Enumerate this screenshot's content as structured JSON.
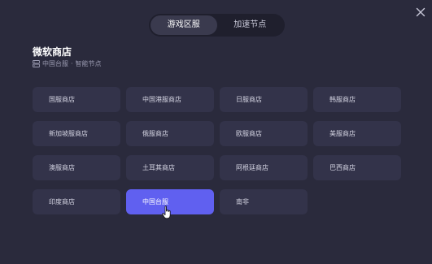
{
  "tabs": [
    {
      "label": "游戏区服",
      "active": true
    },
    {
      "label": "加速节点",
      "active": false
    }
  ],
  "store": {
    "title": "微软商店",
    "region": "中国台服",
    "node": "智能节点"
  },
  "regions": [
    {
      "label": "国服商店"
    },
    {
      "label": "中国港服商店"
    },
    {
      "label": "日服商店"
    },
    {
      "label": "韩服商店"
    },
    {
      "label": "新加坡服商店"
    },
    {
      "label": "俄服商店"
    },
    {
      "label": "欧服商店"
    },
    {
      "label": "美服商店"
    },
    {
      "label": "澳服商店"
    },
    {
      "label": "土耳其商店"
    },
    {
      "label": "阿根廷商店"
    },
    {
      "label": "巴西商店"
    },
    {
      "label": "印度商店"
    },
    {
      "label": "中国台服",
      "selected": true
    },
    {
      "label": "南非"
    }
  ],
  "colors": {
    "background": "#2a2a3c",
    "cell": "#33334a",
    "selected": "#6060f0",
    "tab_track": "#1f1f2d",
    "tab_active": "#3a3a4e"
  },
  "icons": {
    "close": "close-icon",
    "node": "server-icon",
    "cursor": "hand-pointer-icon"
  }
}
